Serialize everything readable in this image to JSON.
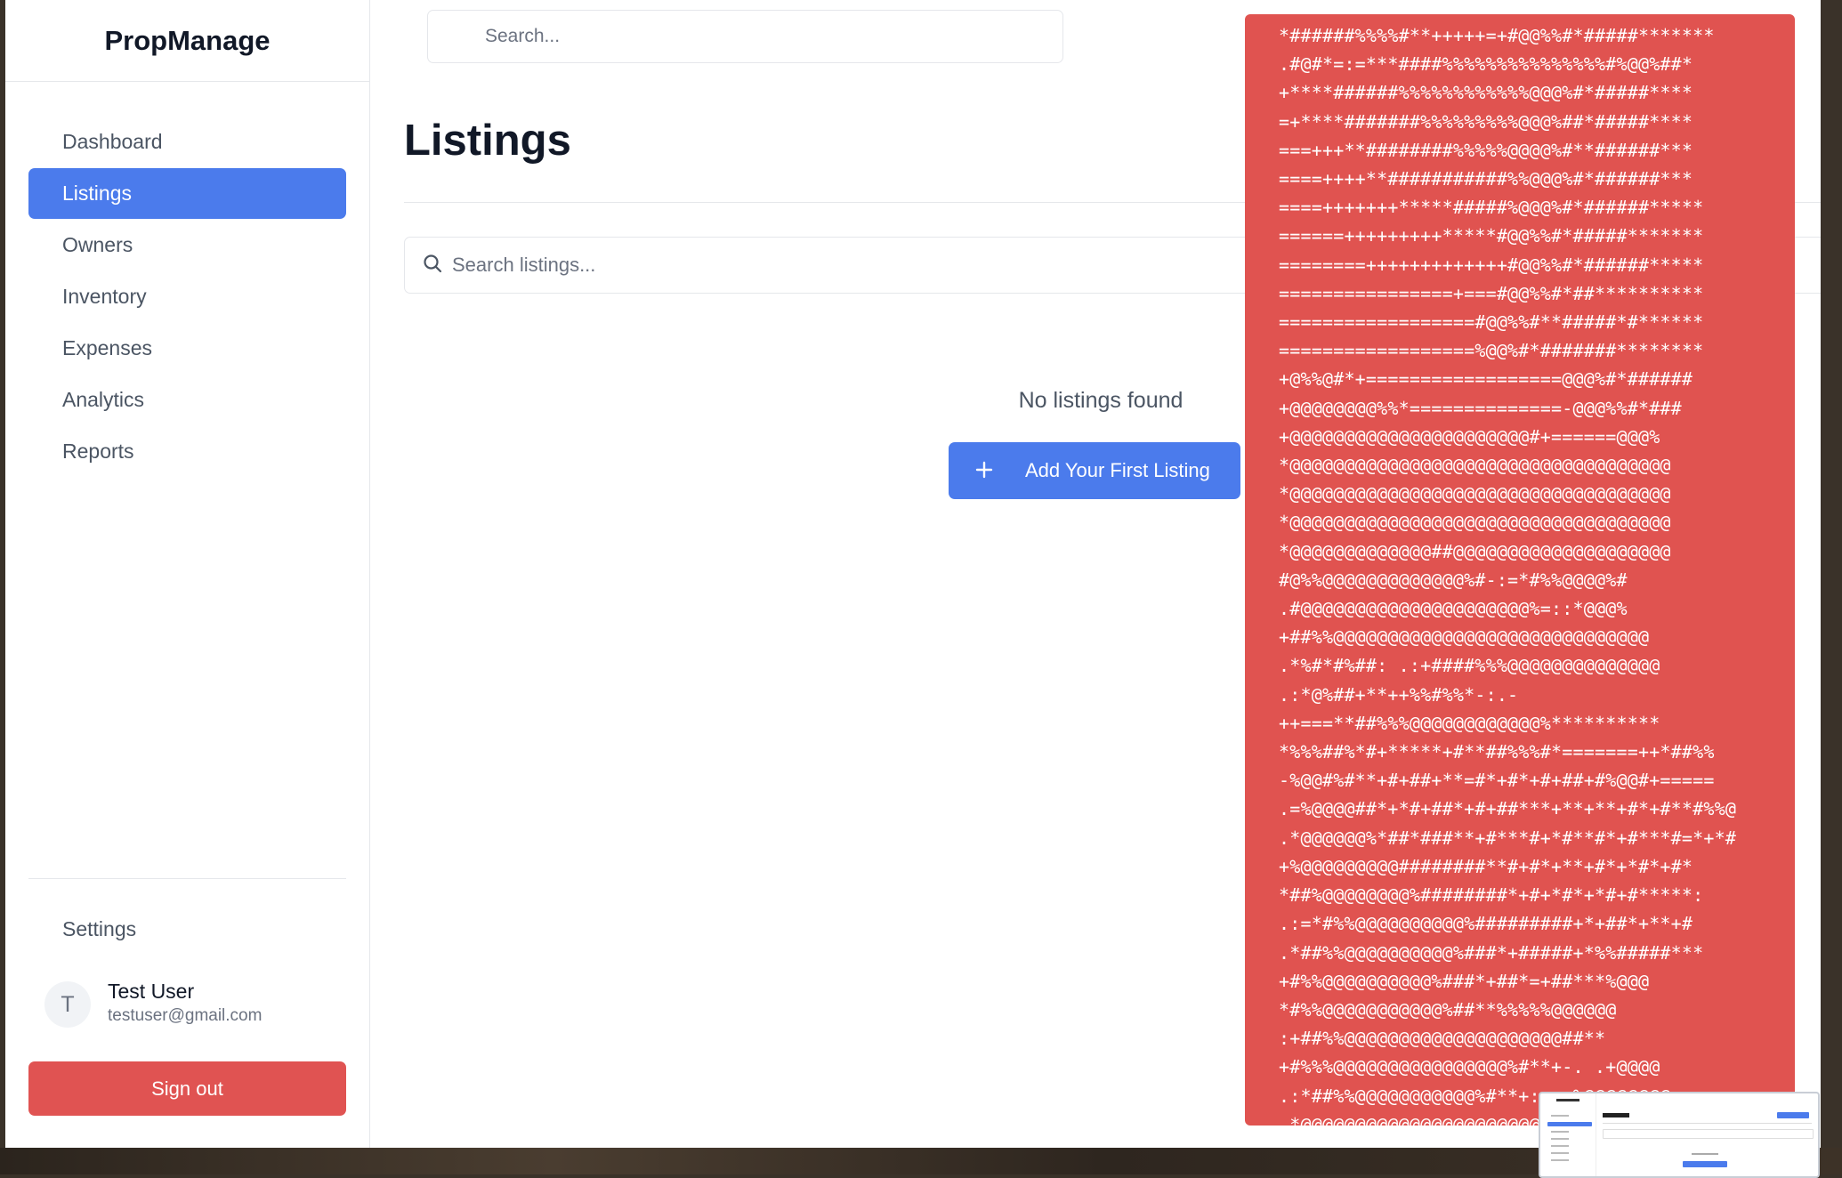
{
  "sidebar": {
    "brand": "PropManage",
    "nav": [
      {
        "label": "Dashboard"
      },
      {
        "label": "Listings",
        "active": true
      },
      {
        "label": "Owners"
      },
      {
        "label": "Inventory"
      },
      {
        "label": "Expenses"
      },
      {
        "label": "Analytics"
      },
      {
        "label": "Reports"
      }
    ],
    "settings_label": "Settings",
    "user": {
      "initial": "T",
      "name": "Test User",
      "email": "testuser@gmail.com"
    },
    "signout_label": "Sign out"
  },
  "header": {
    "search_placeholder": "Search..."
  },
  "main": {
    "title": "Listings",
    "search_placeholder": "Search listings...",
    "empty_text": "No listings found",
    "add_button_label": "Add Your First Listing",
    "add_button_icon": "plus-icon"
  },
  "overlay": {
    "ascii_lines": [
      "*######%%%%#**+++++=+#@@%%#*#####*******",
      ".#@#*=:=***####%%%%%%%%%%%%%%%#%@@%##*",
      "+****######%%%%%%%%%%%%@@@%#*#####****",
      "=+****#######%%%%%%%%%@@@%##*#####****",
      "===+++**########%%%%%@@@@%#**######***",
      "====++++**###########%%@@@%#*######***",
      "====+++++++*****#####%@@@%#*######*****",
      "======+++++++++*****#@@%%#*#####*******",
      "========+++++++++++++#@@%%#*######*****",
      "================+===#@@%%#*##**********",
      "==================#@@%%#**#####*#******",
      "==================%@@%#*#######********",
      "+@%%@#*+==================@@@%#*######",
      "+@@@@@@@@%%*==============-@@@%%#*###",
      "+@@@@@@@@@@@@@@@@@@@@@@#+======@@@%",
      "*@@@@@@@@@@@@@@@@@@@@@@@@@@@@@@@@@@@",
      "*@@@@@@@@@@@@@@@@@@@@@@@@@@@@@@@@@@@",
      "*@@@@@@@@@@@@@@@@@@@@@@@@@@@@@@@@@@@",
      "*@@@@@@@@@@@@@##@@@@@@@@@@@@@@@@@@@@",
      "#@%%@@@@@@@@@@@@@%#-:=*#%%@@@@%#",
      ".#@@@@@@@@@@@@@@@@@@@@@%=::*@@@%",
      "+##%%@@@@@@@@@@@@@@@@@@@@@@@@@@@@@",
      ".*%#*#%##: .:+####%%%@@@@@@@@@@@@@@",
      ".:*@%##+**++%%#%%*-:.-",
      "++===**##%%%@@@@@@@@@@@@%**********",
      "*%%%##%*#+*****+#**##%%%#*=======++*##%%",
      "-%@@#%#**+#+##+**=#*+#*+#+##+#%@@#+=====",
      ".=%@@@@##*+*#+##*+#+##***+**+**+#*+#**#%%@",
      ".*@@@@@@%*##*###**+#***#+*#**#*+#***#=*+*#",
      "+%@@@@@@@@@########**#+#*+**+#*+*#*+#*",
      "*##%@@@@@@@@%########*+#+*#*+*#+#*****:",
      ".:=*#%%@@@@@@@@@@%#########+*+##*+**+#",
      ".*##%%@@@@@@@@@@%###*+#####+*%%#####***",
      "+#%%@@@@@@@@@@%###*+##*=+##***%@@@",
      "*#%%@@@@@@@@@@@%##**%%%%%@@@@@@",
      ":+##%%@@@@@@@@@@@@@@@@@@@@##**",
      "+#%%%@@@@@@@@@@@@@@@@%#**+-. .+@@@@",
      ".:*##%%@@@@@@@@@@@%#**+:  -%@@@@@@@@",
      ".*@@@@@@@@@@@@@@@@@@@@@@@@@@@@@@"
    ]
  }
}
